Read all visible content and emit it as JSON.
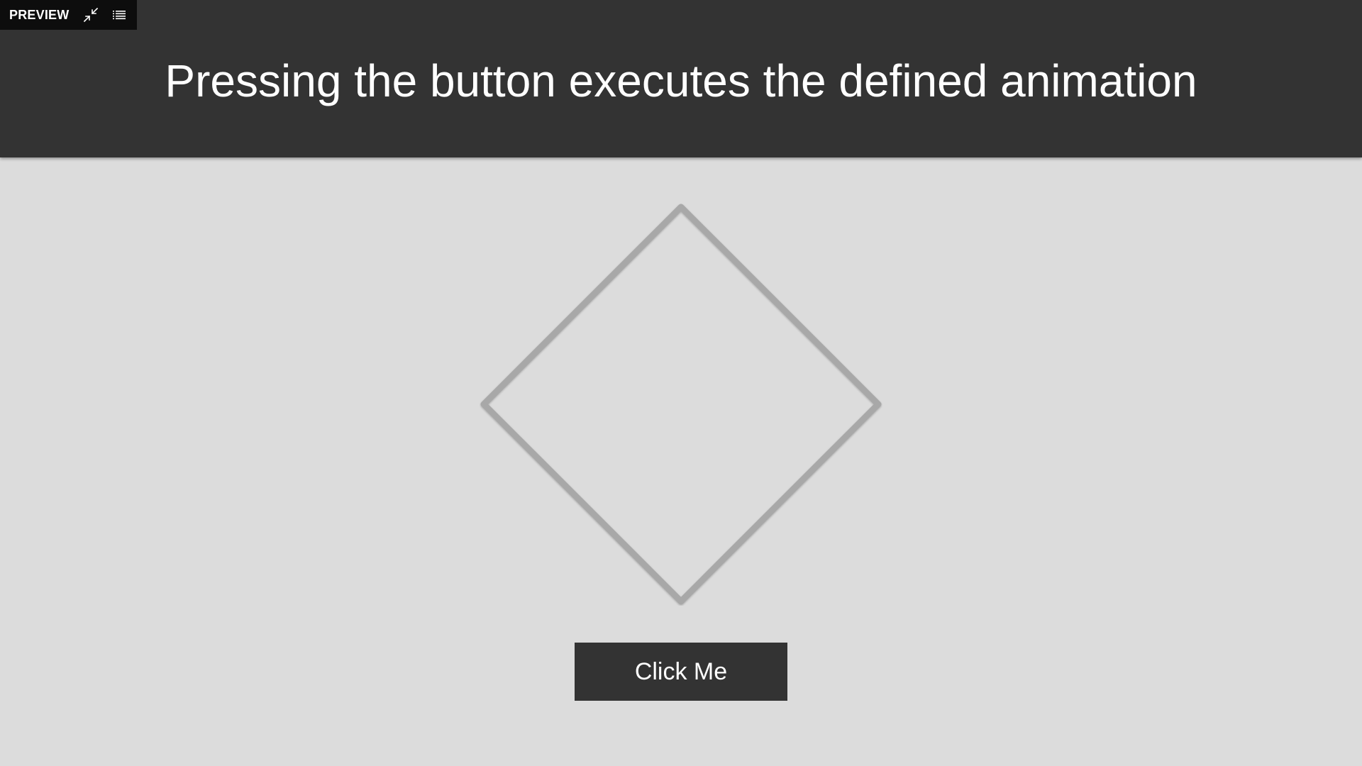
{
  "toolbar": {
    "label": "PREVIEW",
    "icons": [
      "collapse-icon",
      "list-menu-icon"
    ]
  },
  "header": {
    "title": "Pressing the button executes the defined animation"
  },
  "canvas": {
    "shape": "diamond-outline",
    "shape_stroke_color": "#a8a8a8",
    "background_color": "#dcdcdc",
    "header_color": "#333333"
  },
  "button": {
    "label": "Click Me"
  }
}
